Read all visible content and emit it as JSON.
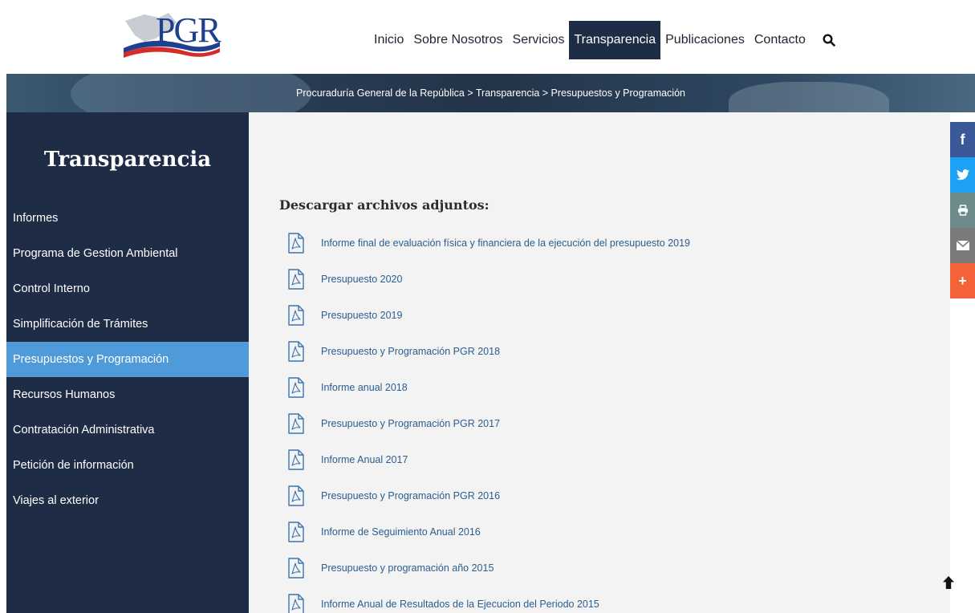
{
  "header": {
    "logo_text": "PGR",
    "nav": [
      {
        "label": "Inicio"
      },
      {
        "label": "Sobre Nosotros"
      },
      {
        "label": "Servicios"
      },
      {
        "label": "Transparencia"
      },
      {
        "label": "Publicaciones"
      },
      {
        "label": "Contacto"
      }
    ],
    "active_nav": "Transparencia",
    "search_icon": "search-icon"
  },
  "breadcrumb": {
    "text": "Procuraduría General de la República > Transparencia > Presupuestos y Programación"
  },
  "sidebar": {
    "title": "Transparencia",
    "items": [
      {
        "label": "Informes"
      },
      {
        "label": "Programa de Gestion Ambiental"
      },
      {
        "label": "Control Interno"
      },
      {
        "label": "Simplificación de Trámites"
      },
      {
        "label": "Presupuestos y Programación"
      },
      {
        "label": "Recursos Humanos"
      },
      {
        "label": "Contratación Administrativa"
      },
      {
        "label": "Petición de información"
      },
      {
        "label": "Viajes al exterior"
      }
    ],
    "active_item": "Presupuestos y Programación"
  },
  "main": {
    "section_title": "Descargar archivos adjuntos:",
    "files": [
      {
        "label": " Informe final de evaluación física y financiera de la ejecución del presupuesto 2019"
      },
      {
        "label": "Presupuesto 2020"
      },
      {
        "label": "Presupuesto 2019"
      },
      {
        "label": "Presupuesto y Programación PGR 2018"
      },
      {
        "label": "Informe anual 2018"
      },
      {
        "label": "Presupuesto y Programación PGR 2017"
      },
      {
        "label": "Informe Anual 2017"
      },
      {
        "label": "Presupuesto y Programación PGR 2016"
      },
      {
        "label": "Informe de Seguimiento Anual 2016"
      },
      {
        "label": "Presupuesto y programación año 2015"
      },
      {
        "label": "Informe Anual de Resultados de la Ejecucion del Periodo 2015"
      }
    ]
  },
  "social": {
    "facebook": "f",
    "more": "+"
  },
  "colors": {
    "navy": "#1e2d45",
    "active_blue": "#4f9ad9",
    "link": "#2a5e8f",
    "facebook": "#3b5998",
    "twitter": "#1da1f2",
    "print": "#6d8b8a",
    "email": "#7a7a7a",
    "more": "#f4623a"
  }
}
